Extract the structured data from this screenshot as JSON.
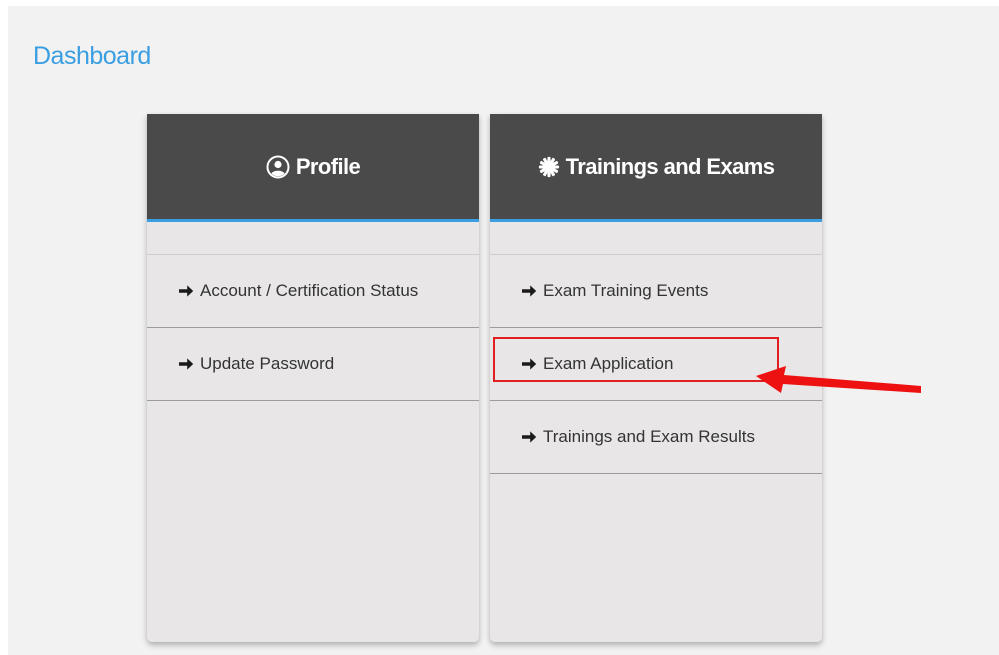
{
  "page": {
    "title": "Dashboard"
  },
  "cards": {
    "profile": {
      "title": "Profile",
      "icon": "user-circle-icon",
      "items": [
        {
          "label": "Account / Certification Status"
        },
        {
          "label": "Update Password"
        }
      ]
    },
    "trainings": {
      "title": "Trainings and Exams",
      "icon": "gear-icon",
      "items": [
        {
          "label": "Exam Training Events"
        },
        {
          "label": "Exam Application"
        },
        {
          "label": "Trainings and Exam Results"
        }
      ]
    }
  },
  "annotation": {
    "highlighted_item": "Exam Application",
    "color": "#e02020"
  },
  "colors": {
    "accent": "#3a9ee2",
    "header_bg": "#4a4a4a",
    "card_bg": "#e8e6e6",
    "page_bg": "#f2f2f2"
  }
}
